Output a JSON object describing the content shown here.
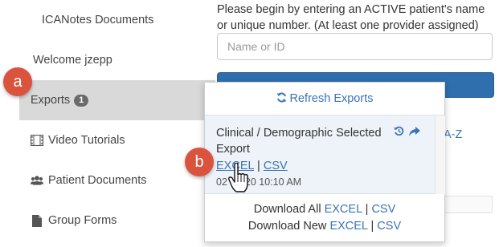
{
  "sidebar": {
    "items": [
      {
        "label": "ICANotes Documents"
      },
      {
        "label": "Welcome jzepp"
      },
      {
        "label": "Exports",
        "badge": "1"
      },
      {
        "label": "Video Tutorials",
        "icon": "film-icon"
      },
      {
        "label": "Patient Documents",
        "icon": "users-icon"
      },
      {
        "label": "Group Forms",
        "icon": "file-icon"
      }
    ]
  },
  "main": {
    "instructions": "Please begin by entering an ACTIVE patient's name or unique number. (At least one provider assigned)",
    "search_placeholder": "Name or ID",
    "az_link": "A-Z"
  },
  "popup": {
    "refresh_label": "Refresh Exports",
    "export": {
      "title": "Clinical / Demographic Selected Export",
      "excel_label": "EXCEL",
      "separator": "|",
      "csv_label": "CSV",
      "timestamp_visible": "02",
      "timestamp_tail": "20 10:10 AM"
    },
    "download_all": {
      "prefix": "Download All",
      "excel": "EXCEL",
      "separator": "|",
      "csv": "CSV"
    },
    "download_new": {
      "prefix": "Download New",
      "excel": "EXCEL",
      "separator": "|",
      "csv": "CSV"
    }
  },
  "callouts": {
    "a": "a",
    "b": "b"
  },
  "colors": {
    "accent": "#3a74b6",
    "callout": "#d9533d",
    "primary_button": "#2f6fad",
    "badge": "#6b6b6b"
  }
}
